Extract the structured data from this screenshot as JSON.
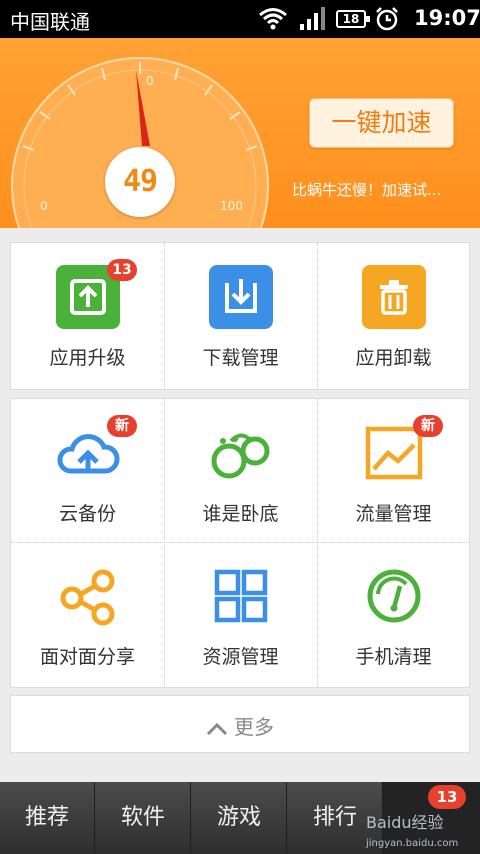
{
  "status_bar": {
    "carrier": "中国联通",
    "battery": "18",
    "time": "19:07"
  },
  "header": {
    "speed_value": "49",
    "gauge_min": "0",
    "gauge_top": "0",
    "gauge_max": "100",
    "accelerate_button": "一键加速",
    "slogan": "比蜗牛还慢！加速试..."
  },
  "grid1": [
    {
      "label": "应用升级",
      "badge": "13",
      "icon": "upgrade-icon",
      "color": "#4bb13a"
    },
    {
      "label": "下载管理",
      "icon": "download-icon",
      "color": "#3c8fe6"
    },
    {
      "label": "应用卸载",
      "icon": "trash-icon",
      "color": "#f5a623"
    }
  ],
  "grid2": [
    {
      "label": "云备份",
      "badge": "新",
      "icon": "cloud-upload-icon",
      "color": "#3c8fe6"
    },
    {
      "label": "谁是卧底",
      "icon": "handcuffs-icon",
      "color": "#4bb13a"
    },
    {
      "label": "流量管理",
      "badge": "新",
      "icon": "traffic-chart-icon",
      "color": "#f5a623"
    },
    {
      "label": "面对面分享",
      "icon": "share-icon",
      "color": "#f5a623"
    },
    {
      "label": "资源管理",
      "icon": "grid-icon",
      "color": "#3c8fe6"
    },
    {
      "label": "手机清理",
      "icon": "speedometer-icon",
      "color": "#4bb13a"
    }
  ],
  "more_label": "更多",
  "tabs": [
    "推荐",
    "软件",
    "游戏",
    "排行"
  ],
  "tab_badge": "13",
  "watermark": {
    "line1": "Baidu经验",
    "line2": "jingyan.baidu.com"
  }
}
